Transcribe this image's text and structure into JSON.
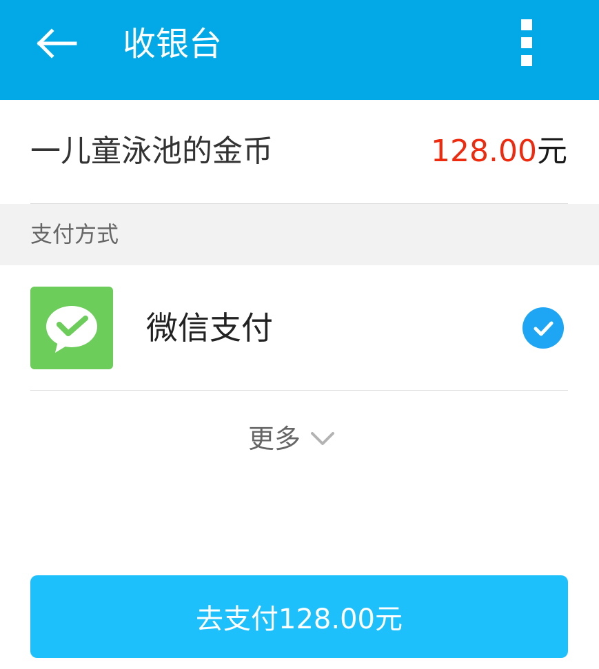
{
  "header": {
    "title": "收银台",
    "back_icon": "arrow-left-icon",
    "menu_icon": "overflow-menu-icon",
    "background_color": "#03a9e6"
  },
  "order": {
    "item_name": "一儿童泳池的金币",
    "amount": "128.00",
    "currency": "元",
    "amount_color": "#ee2b0e"
  },
  "payment": {
    "section_title": "支付方式",
    "methods": [
      {
        "label": "微信支付",
        "icon": "wechat-pay-icon",
        "selected": true
      }
    ],
    "more_label": "更多",
    "more_icon": "chevron-down-icon"
  },
  "submit": {
    "label": "去支付128.00元",
    "button_color": "#1ec0fb"
  }
}
